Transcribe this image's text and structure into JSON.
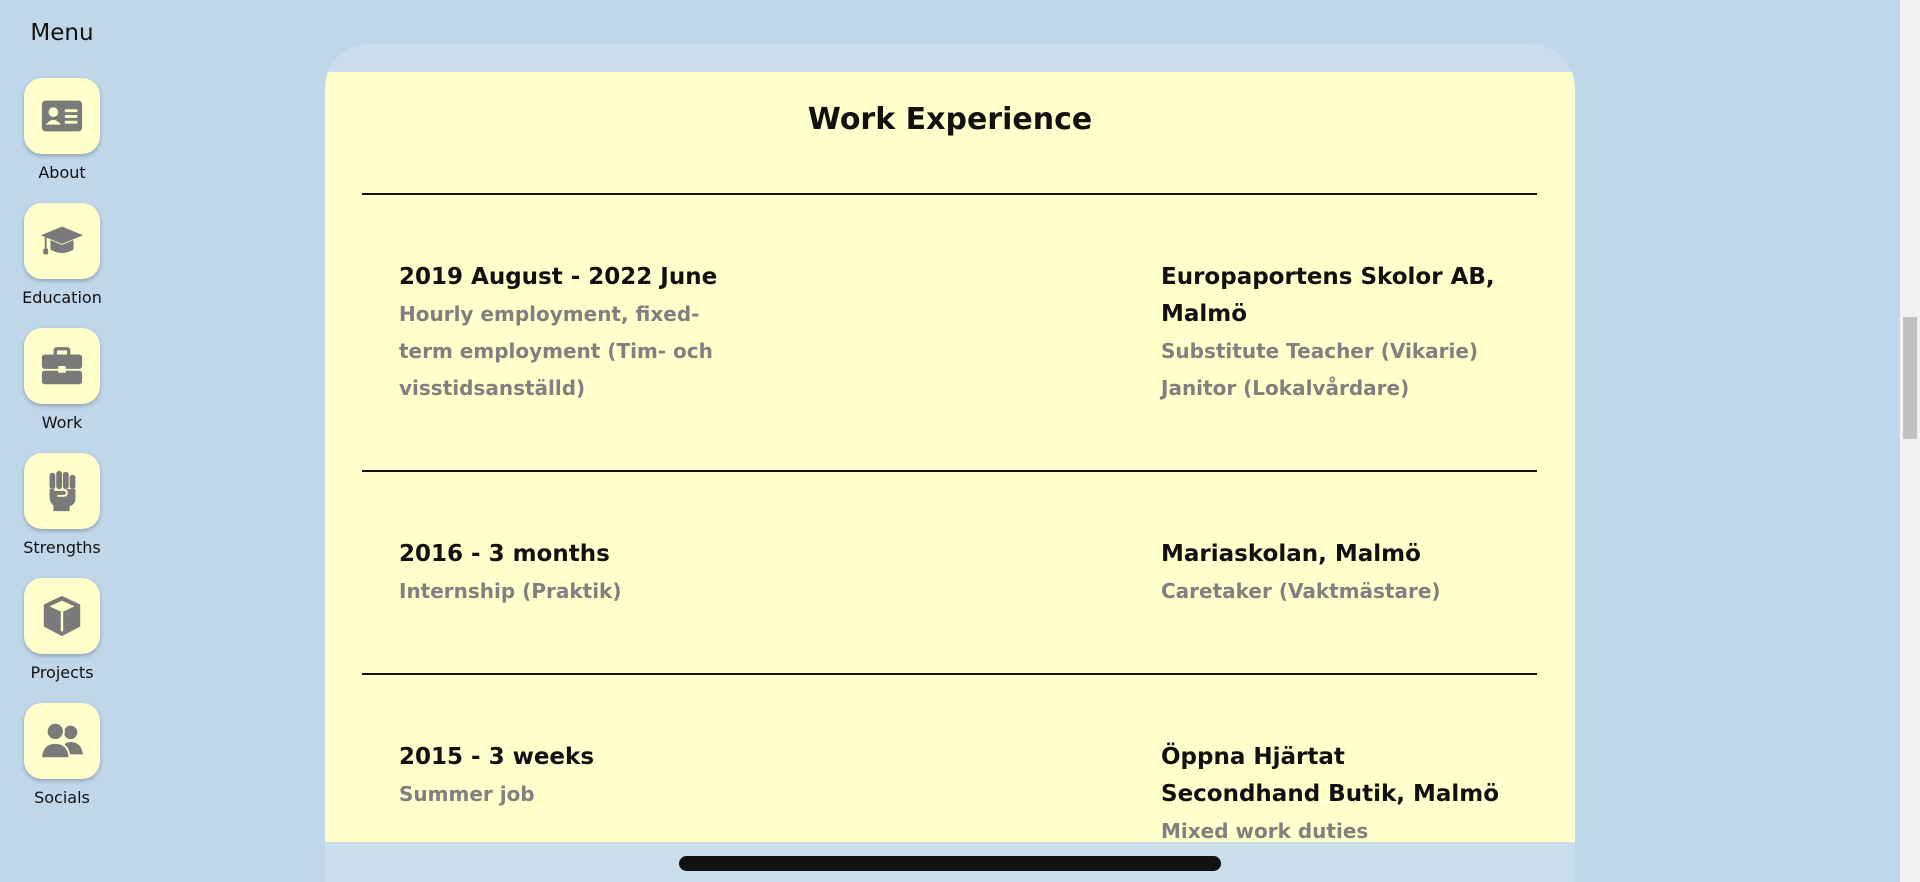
{
  "sidebar": {
    "title": "Menu",
    "items": [
      {
        "label": "About",
        "icon": "id-card-icon"
      },
      {
        "label": "Education",
        "icon": "graduation-cap-icon"
      },
      {
        "label": "Work",
        "icon": "briefcase-icon"
      },
      {
        "label": "Strengths",
        "icon": "fist-icon"
      },
      {
        "label": "Projects",
        "icon": "box-icon"
      },
      {
        "label": "Socials",
        "icon": "users-icon"
      }
    ]
  },
  "main": {
    "title": "Work Experience",
    "entries": [
      {
        "period": "2019 August - 2022 June",
        "type": "Hourly employment, fixed-term employment (Tim- och visstidsanställd)",
        "employer": "Europaportens Skolor AB, Malmö",
        "roles": [
          "Substitute Teacher (Vikarie)",
          "Janitor (Lokalvårdare)"
        ]
      },
      {
        "period": "2016 - 3 months",
        "type": "Internship (Praktik)",
        "employer": "Mariaskolan, Malmö",
        "roles": [
          "Caretaker (Vaktmästare)"
        ]
      },
      {
        "period": "2015 - 3 weeks",
        "type": "Summer job",
        "employer": "Öppna Hjärtat Secondhand Butik, Malmö",
        "roles": [
          "Mixed work duties"
        ]
      }
    ]
  },
  "colors": {
    "background": "#c0d7ea",
    "card": "#ffffcc",
    "tile": "#ffffcc",
    "icon": "#7a7a7a",
    "muted_text": "#808080"
  }
}
